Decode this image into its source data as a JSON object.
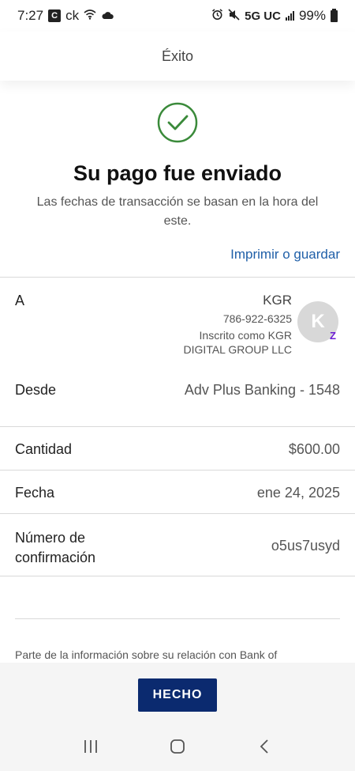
{
  "status_bar": {
    "time": "7:27",
    "app_badge": "C",
    "ck_text": "ck",
    "network": "5G UC",
    "battery": "99%"
  },
  "header": {
    "title": "Éxito"
  },
  "success": {
    "title": "Su pago fue enviado",
    "subtitle": "Las fechas de transacción se basan en la hora del este.",
    "print_link": "Imprimir o guardar",
    "check_color": "#3a8a3a"
  },
  "details": {
    "to_label": "A",
    "recipient_name": "KGR",
    "recipient_phone": "786-922-6325",
    "recipient_enrolled_line1": "Inscrito como KGR",
    "recipient_enrolled_line2": "DIGITAL GROUP LLC",
    "avatar_initial": "K",
    "zelle_badge": "Z",
    "from_label": "Desde",
    "from_value": "Adv Plus Banking - 1548",
    "amount_label": "Cantidad",
    "amount_value": "$600.00",
    "date_label": "Fecha",
    "date_value": "ene 24, 2025",
    "confirmation_label_line1": "Número de",
    "confirmation_label_line2": "confirmación",
    "confirmation_value": "o5us7usyd"
  },
  "disclaimer": "Parte de la información sobre su relación con Bank of",
  "done_button": "HECHO",
  "colors": {
    "accent_link": "#1f5fa8",
    "primary_button": "#0b2a6f",
    "zelle": "#6d1ed4"
  }
}
